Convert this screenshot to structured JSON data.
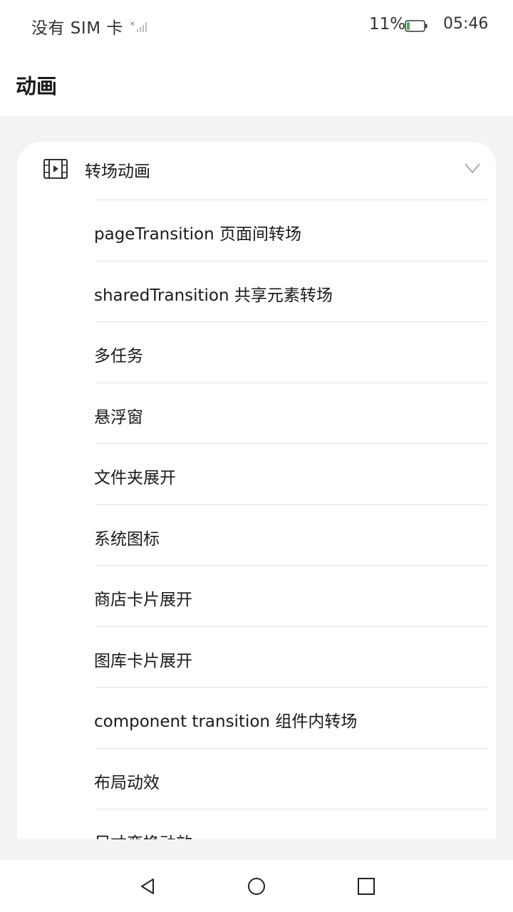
{
  "status_bar": {
    "carrier": "没有 SIM 卡",
    "battery_percent": "11%",
    "time": "05:46",
    "icons": [
      "signal-icon",
      "battery-icon"
    ]
  },
  "header": {
    "title": "动画"
  },
  "card": {
    "title": "转场动画",
    "icon": "film-icon",
    "expand_icon": "chevron-down-icon",
    "items": [
      {
        "label": "pageTransition 页面间转场"
      },
      {
        "label": "sharedTransition 共享元素转场"
      },
      {
        "label": "多任务"
      },
      {
        "label": "悬浮窗"
      },
      {
        "label": "文件夹展开"
      },
      {
        "label": "系统图标"
      },
      {
        "label": "商店卡片展开"
      },
      {
        "label": "图库卡片展开"
      },
      {
        "label": "component transition 组件内转场"
      },
      {
        "label": "布局动效"
      },
      {
        "label": "尺寸变换动效"
      }
    ]
  },
  "nav_bar": {
    "buttons": [
      "back-icon",
      "home-icon",
      "recent-apps-icon"
    ]
  },
  "colors": {
    "background": "#f1f3f5",
    "surface": "#ffffff",
    "divider": "#e3e3e3",
    "text": "#1a1a1a"
  }
}
